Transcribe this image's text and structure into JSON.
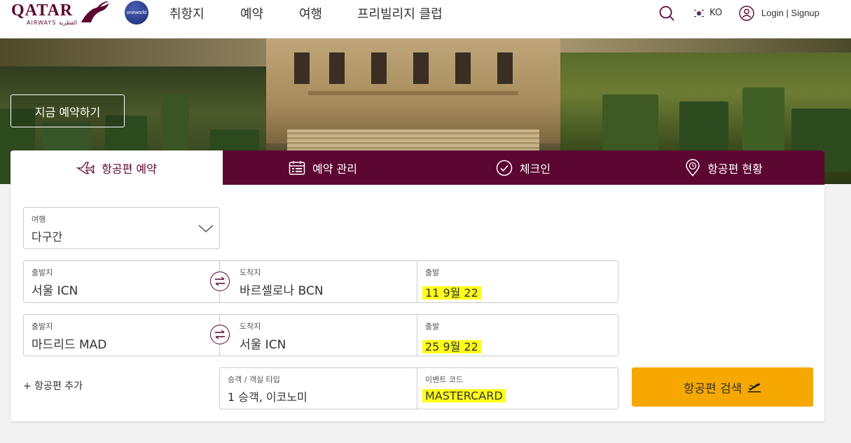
{
  "header": {
    "logo_text": "QATAR",
    "logo_sub": "AIRWAYS القطرية",
    "alliance_badge": "oneworld",
    "nav": [
      "취항지",
      "예약",
      "여행",
      "프리빌리지 클럽"
    ],
    "language": "KO",
    "login": "Login | Signup"
  },
  "hero": {
    "cta_label": "지금 예약하기"
  },
  "booking": {
    "tabs": [
      {
        "label": "항공편 예약",
        "icon": "plane-icon",
        "active": true
      },
      {
        "label": "예약 관리",
        "icon": "calendar-icon",
        "active": false
      },
      {
        "label": "체크인",
        "icon": "check-circle-icon",
        "active": false
      },
      {
        "label": "항공편 현황",
        "icon": "location-clock-icon",
        "active": false
      }
    ],
    "trip_type": {
      "label": "여행",
      "value": "다구간"
    },
    "legs": [
      {
        "from_label": "출발지",
        "from": "서울 ICN",
        "to_label": "도착지",
        "to": "바르셀로나 BCN",
        "date_label": "출발",
        "date": "11 9월 22"
      },
      {
        "from_label": "출발지",
        "from": "마드리드 MAD",
        "to_label": "도착지",
        "to": "서울 ICN",
        "date_label": "출발",
        "date": "25 9월 22"
      }
    ],
    "add_flight": "+ 항공편 추가",
    "passengers": {
      "label": "승객 / 객실 타입",
      "value": "1 승객, 이코노미"
    },
    "promo": {
      "label": "이벤트 코드",
      "value": "MASTERCARD"
    },
    "search_label": "항공편 검색"
  },
  "colors": {
    "brand": "#5c0632",
    "search_button": "#f7a800",
    "highlight": "#ffff1a"
  }
}
